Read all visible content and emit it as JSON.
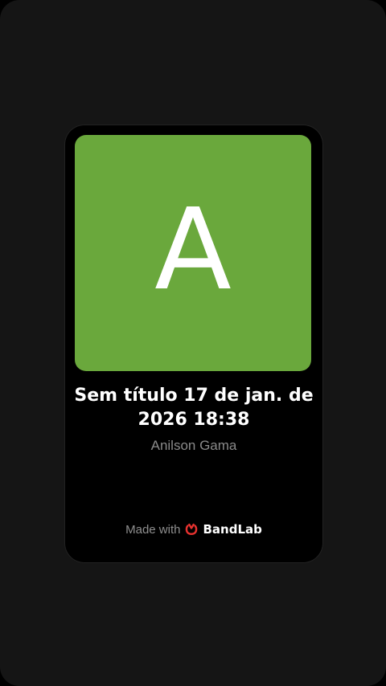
{
  "card": {
    "cover_letter": "A",
    "cover_color": "#6aa83c",
    "title": "Sem título 17 de jan. de 2026 18:38",
    "artist": "Anilson Gama"
  },
  "footer": {
    "made_with": "Made with",
    "brand": "BandLab",
    "brand_icon": "bandlab-logo-icon",
    "brand_color": "#e8322f"
  }
}
